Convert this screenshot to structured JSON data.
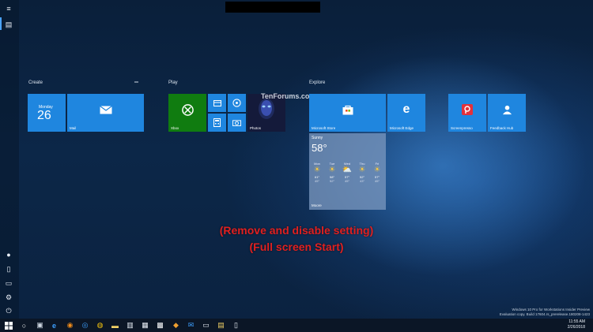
{
  "groups": {
    "create": "Create",
    "play": "Play",
    "explore": "Explore"
  },
  "group_menu": "═",
  "tiles": {
    "calendar": {
      "day": "Monday",
      "date": "26"
    },
    "mail": "Mail",
    "xbox": "Xbox",
    "photos": "Photos",
    "store": "Microsoft Store",
    "edge": "Microsoft Edge",
    "screenpresso": "Screenpresso",
    "feedback": "Feedback Hub"
  },
  "weather": {
    "condition": "Sunny",
    "temp": "58°",
    "location": "Moore",
    "forecast": [
      {
        "day": "Mon",
        "hi": "61°",
        "lo": "45°"
      },
      {
        "day": "Tue",
        "hi": "58°",
        "lo": "52°"
      },
      {
        "day": "Wed",
        "hi": "57°",
        "lo": "45°"
      },
      {
        "day": "Thu",
        "hi": "52°",
        "lo": "43°"
      },
      {
        "day": "Fri",
        "hi": "57°",
        "lo": "45°"
      }
    ]
  },
  "watermark": "TenForums.co",
  "banner": {
    "line1": "(Remove and disable setting)",
    "line2": "(Full screen Start)"
  },
  "windows_mark": {
    "line1": "Windows 10 Pro for Workstations Insider Preview",
    "line2": "Evaluation copy. Build 17604.rs_prerelease.180208-1423"
  },
  "clock": {
    "time": "11:55 AM",
    "date": "2/26/2018"
  },
  "colors": {
    "tile_blue": "#1f86df",
    "xbox_green": "#107c10",
    "banner_red": "#e02020"
  }
}
